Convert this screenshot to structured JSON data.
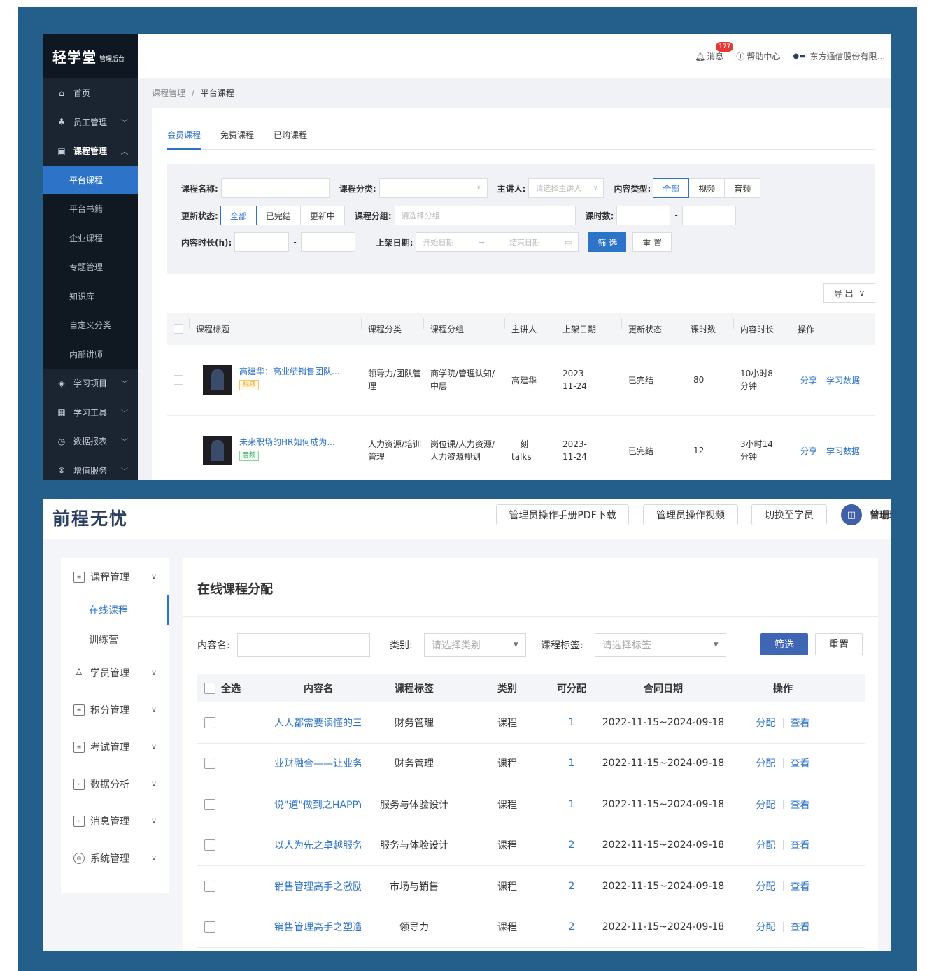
{
  "shot1": {
    "logo": {
      "title": "轻学堂",
      "subtitle": "管理后台"
    },
    "sidebar": {
      "items": [
        {
          "label": "首页",
          "icon": "home-icon"
        },
        {
          "label": "员工管理",
          "icon": "org-icon"
        },
        {
          "label": "课程管理",
          "icon": "book-icon"
        }
      ],
      "subitems": [
        "平台课程",
        "平台书籍",
        "企业课程",
        "专题管理",
        "知识库",
        "自定义分类",
        "内部讲师"
      ],
      "bottom_items": [
        {
          "label": "学习项目",
          "icon": "layers-icon"
        },
        {
          "label": "学习工具",
          "icon": "grid-icon"
        },
        {
          "label": "数据报表",
          "icon": "clock-icon"
        },
        {
          "label": "增值服务",
          "icon": "currency-icon"
        }
      ]
    },
    "topbar": {
      "messages": "消息",
      "badge": "177",
      "help": "帮助中心",
      "company": "东方通信股份有限..."
    },
    "breadcrumb": {
      "parent": "课程管理",
      "sep": "/",
      "current": "平台课程"
    },
    "tabs": [
      "会员课程",
      "免费课程",
      "已购课程"
    ],
    "filters": {
      "name_label": "课程名称:",
      "category_label": "课程分类:",
      "speaker_label": "主讲人:",
      "speaker_placeholder": "请选择主讲人",
      "content_type_label": "内容类型:",
      "content_types": [
        "全部",
        "视频",
        "音频"
      ],
      "status_label": "更新状态:",
      "statuses": [
        "全部",
        "已完结",
        "更新中"
      ],
      "group_label": "课程分组:",
      "group_placeholder": "请选择分组",
      "lessons_label": "课时数:",
      "dash": "-",
      "duration_label": "内容时长(h):",
      "date_label": "上架日期:",
      "start_placeholder": "开始日期",
      "arrow": "→",
      "end_placeholder": "结束日期",
      "filter_btn": "筛 选",
      "reset_btn": "重 置"
    },
    "export": "导 出",
    "table": {
      "headers": [
        "课程标题",
        "课程分类",
        "课程分组",
        "主讲人",
        "上架日期",
        "更新状态",
        "课时数",
        "内容时长",
        "操作"
      ],
      "rows": [
        {
          "title": "高建华：高业绩销售团队...",
          "tag": "视频",
          "category": "领导力/团队管理",
          "group": "商学院/管理认知/中层",
          "speaker": "高建华",
          "date": "2023-11-24",
          "status": "已完结",
          "lessons": "80",
          "duration": "10小时8分钟",
          "op1": "分享",
          "op2": "学习数据"
        },
        {
          "title": "未来职场的HR如何成为...",
          "tag": "音频",
          "category": "人力资源/培训管理",
          "group": "岗位课/人力资源/人力资源规划",
          "speaker": "一刻talks",
          "date": "2023-11-24",
          "status": "已完结",
          "lessons": "12",
          "duration": "3小时14分钟",
          "op1": "分享",
          "op2": "学习数据"
        }
      ]
    },
    "colors": {
      "sidebar": "#1b2431",
      "accent": "#2d73c8",
      "video_tag": "#f0a020",
      "audio_tag": "#3aa55a"
    }
  },
  "shot2": {
    "logo": "前程无忧",
    "header_buttons": [
      "管理员操作手册PDF下载",
      "管理员操作视频",
      "切换至学员"
    ],
    "avatar_glyph": "◫",
    "user": "曾珊珊",
    "sidebar": {
      "menu1": "课程管理",
      "subs": [
        "在线课程",
        "训练营"
      ],
      "menus": [
        "学员管理",
        "积分管理",
        "考试管理",
        "数据分析",
        "消息管理",
        "系统管理"
      ]
    },
    "page_title": "在线课程分配",
    "filters": {
      "name_label": "内容名:",
      "category_label": "类别:",
      "category_placeholder": "请选择类别",
      "tag_label": "课程标签:",
      "tag_placeholder": "请选择标签",
      "filter_btn": "筛选",
      "reset_btn": "重置"
    },
    "table": {
      "headers": [
        "全选",
        "内容名",
        "课程标签",
        "类别",
        "可分配",
        "合同日期",
        "操作"
      ],
      "rows": [
        {
          "name": "人人都需要读懂的三...",
          "tag": "财务管理",
          "type": "课程",
          "count": "1",
          "date": "2022-11-15~2024-09-18",
          "op1": "分配",
          "op2": "查看"
        },
        {
          "name": "业财融合——让业务...",
          "tag": "财务管理",
          "type": "课程",
          "count": "1",
          "date": "2022-11-15~2024-09-18",
          "op1": "分配",
          "op2": "查看"
        },
        {
          "name": "说\"道\"做到之HAPPY...",
          "tag": "服务与体验设计",
          "type": "课程",
          "count": "1",
          "date": "2022-11-15~2024-09-18",
          "op1": "分配",
          "op2": "查看"
        },
        {
          "name": "以人为先之卓越服务",
          "tag": "服务与体验设计",
          "type": "课程",
          "count": "2",
          "date": "2022-11-15~2024-09-18",
          "op1": "分配",
          "op2": "查看"
        },
        {
          "name": "销售管理高手之激励...",
          "tag": "市场与销售",
          "type": "课程",
          "count": "2",
          "date": "2022-11-15~2024-09-18",
          "op1": "分配",
          "op2": "查看"
        },
        {
          "name": "销售管理高手之塑造...",
          "tag": "领导力",
          "type": "课程",
          "count": "2",
          "date": "2022-11-15~2024-09-18",
          "op1": "分配",
          "op2": "查看"
        }
      ]
    },
    "colors": {
      "accent": "#2d73c8",
      "logo": "#2b3f63",
      "filter_btn": "#3f66b4"
    }
  }
}
